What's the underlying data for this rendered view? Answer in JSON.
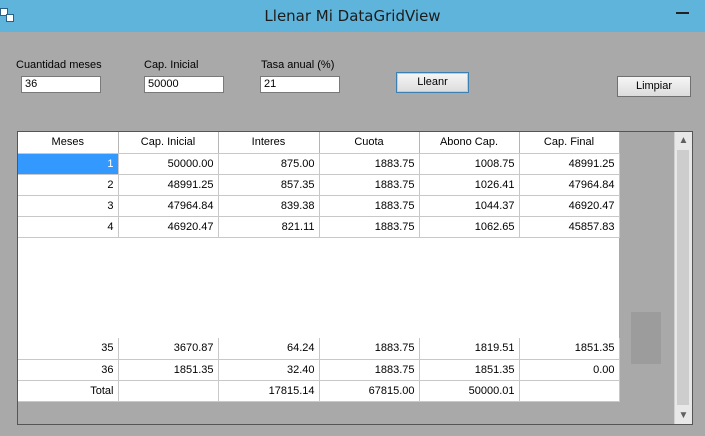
{
  "window": {
    "title": "Llenar Mi DataGridView"
  },
  "form": {
    "months_label": "Cuantidad meses",
    "months_value": "36",
    "capital_label": "Cap. Inicial",
    "capital_value": "50000",
    "rate_label": "Tasa anual (%)",
    "rate_value": "21",
    "fill_button": "Lleanr",
    "clear_button": "Limpiar"
  },
  "grid": {
    "columns": [
      "Meses",
      "Cap. Inicial",
      "Interes",
      "Cuota",
      "Abono Cap.",
      "Cap. Final"
    ],
    "rows_top": [
      [
        "1",
        "50000.00",
        "875.00",
        "1883.75",
        "1008.75",
        "48991.25"
      ],
      [
        "2",
        "48991.25",
        "857.35",
        "1883.75",
        "1026.41",
        "47964.84"
      ],
      [
        "3",
        "47964.84",
        "839.38",
        "1883.75",
        "1044.37",
        "46920.47"
      ],
      [
        "4",
        "46920.47",
        "821.11",
        "1883.75",
        "1062.65",
        "45857.83"
      ]
    ],
    "rows_bottom": [
      [
        "35",
        "3670.87",
        "64.24",
        "1883.75",
        "1819.51",
        "1851.35"
      ],
      [
        "36",
        "1851.35",
        "32.40",
        "1883.75",
        "1851.35",
        "0.00"
      ],
      [
        "Total",
        "",
        "17815.14",
        "67815.00",
        "50000.01",
        ""
      ]
    ]
  },
  "icons": {
    "scroll_up": "▲",
    "scroll_down": "▼"
  }
}
